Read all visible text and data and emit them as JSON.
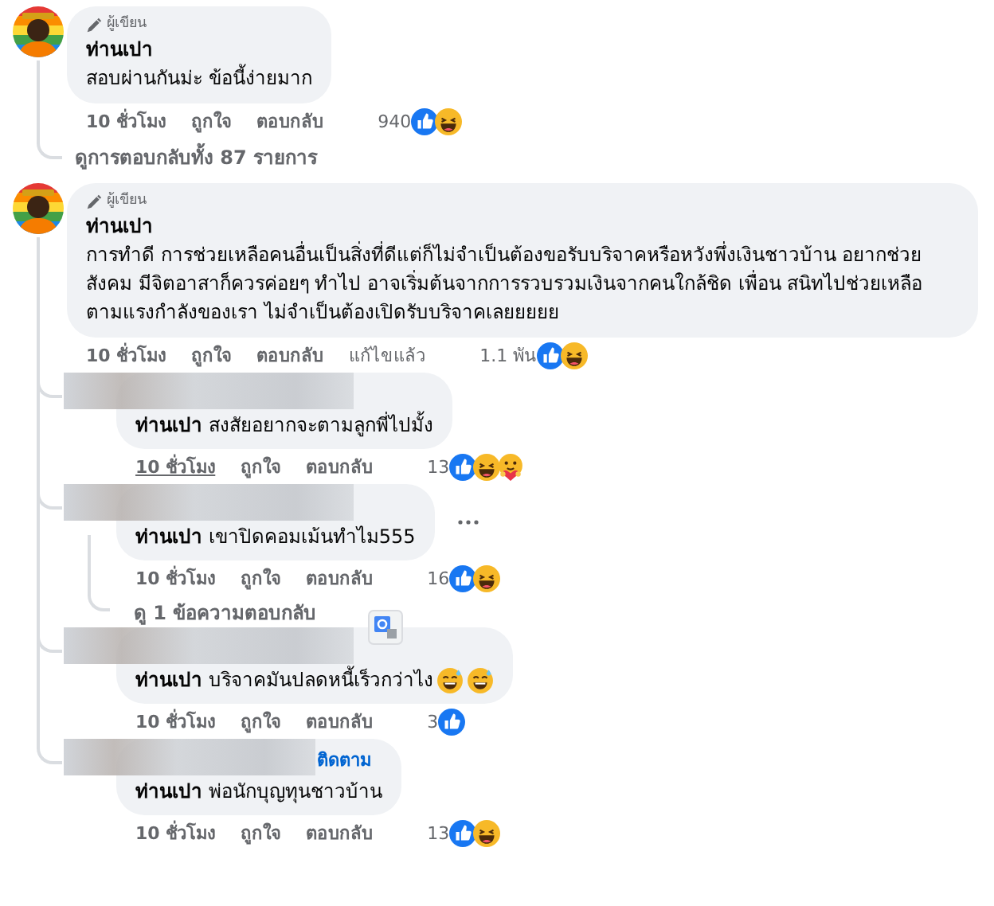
{
  "comments": [
    {
      "badge": "ผู้เขียน",
      "author": "ท่านเปา",
      "text": "สอบผ่านกันม่ะ ข้อนี้ง่ายมาก",
      "time": "10 ชั่วโมง",
      "like_label": "ถูกใจ",
      "reply_label": "ตอบกลับ",
      "reaction_count": "940",
      "reactions": [
        {
          "kind": "like"
        },
        {
          "kind": "haha"
        }
      ],
      "view_replies": "ดูการตอบกลับทั้ง 87 รายการ"
    },
    {
      "badge": "ผู้เขียน",
      "author": "ท่านเปา",
      "text": "การทำดี การช่วยเหลือคนอื่นเป็นสิ่งที่ดีแต่ก็ไม่จำเป็นต้องขอรับบริจาคหรือหวังพึ่งเงินชาวบ้าน อยากช่วยสังคม มีจิตอาสาก็ควรค่อยๆ ทำไป อาจเริ่มต้นจากการรวบรวมเงินจากคนใกล้ชิด เพื่อน สนิทไปช่วยเหลือตามแรงกำลังของเรา ไม่จำเป็นต้องเปิดรับบริจาคเลยยยยย",
      "time": "10 ชั่วโมง",
      "like_label": "ถูกใจ",
      "reply_label": "ตอบกลับ",
      "edited_label": "แก้ไขแล้ว",
      "reaction_count": "1.1 พัน",
      "reactions": [
        {
          "kind": "like"
        },
        {
          "kind": "haha"
        }
      ],
      "replies": [
        {
          "name_blurred": true,
          "text": "**ท่านเปา** สงสัยอยากจะตามลูกพี่ไปมั้ง",
          "time": "10 ชั่วโมง",
          "time_hovered": true,
          "like_label": "ถูกใจ",
          "reply_label": "ตอบกลับ",
          "reaction_count": "13",
          "reactions": [
            {
              "kind": "like"
            },
            {
              "kind": "haha"
            },
            {
              "kind": "care"
            }
          ]
        },
        {
          "name_blurred": true,
          "text": "**ท่านเปา** เขาปิดคอมเม้นทำไม555",
          "menu_shown": true,
          "time": "10 ชั่วโมง",
          "time_hovered": false,
          "like_label": "ถูกใจ",
          "reply_label": "ตอบกลับ",
          "reaction_count": "16",
          "reactions": [
            {
              "kind": "like"
            },
            {
              "kind": "haha"
            }
          ],
          "view_replies": "ดู 1 ข้อความตอบกลับ"
        },
        {
          "name_blurred": true,
          "translate_shown": true,
          "text": "**ท่านเปา** บริจาคมันปลดหนี้เร็วกว่าไง",
          "emojis": [
            {
              "kind": "sweat_smile"
            },
            {
              "kind": "sweat_smile"
            }
          ],
          "time": "10 ชั่วโมง",
          "time_hovered": false,
          "like_label": "ถูกใจ",
          "reply_label": "ตอบกลับ",
          "reaction_count": "3",
          "reactions": [
            {
              "kind": "like"
            }
          ]
        },
        {
          "name_blurred": true,
          "follow_label": "ติดตาม",
          "text": "**ท่านเปา** พ่อนักบุญทุนชาวบ้าน",
          "time": "10 ชั่วโมง",
          "time_hovered": false,
          "like_label": "ถูกใจ",
          "reply_label": "ตอบกลับ",
          "reaction_count": "13",
          "reactions": [
            {
              "kind": "like"
            },
            {
              "kind": "haha"
            }
          ]
        }
      ]
    }
  ]
}
